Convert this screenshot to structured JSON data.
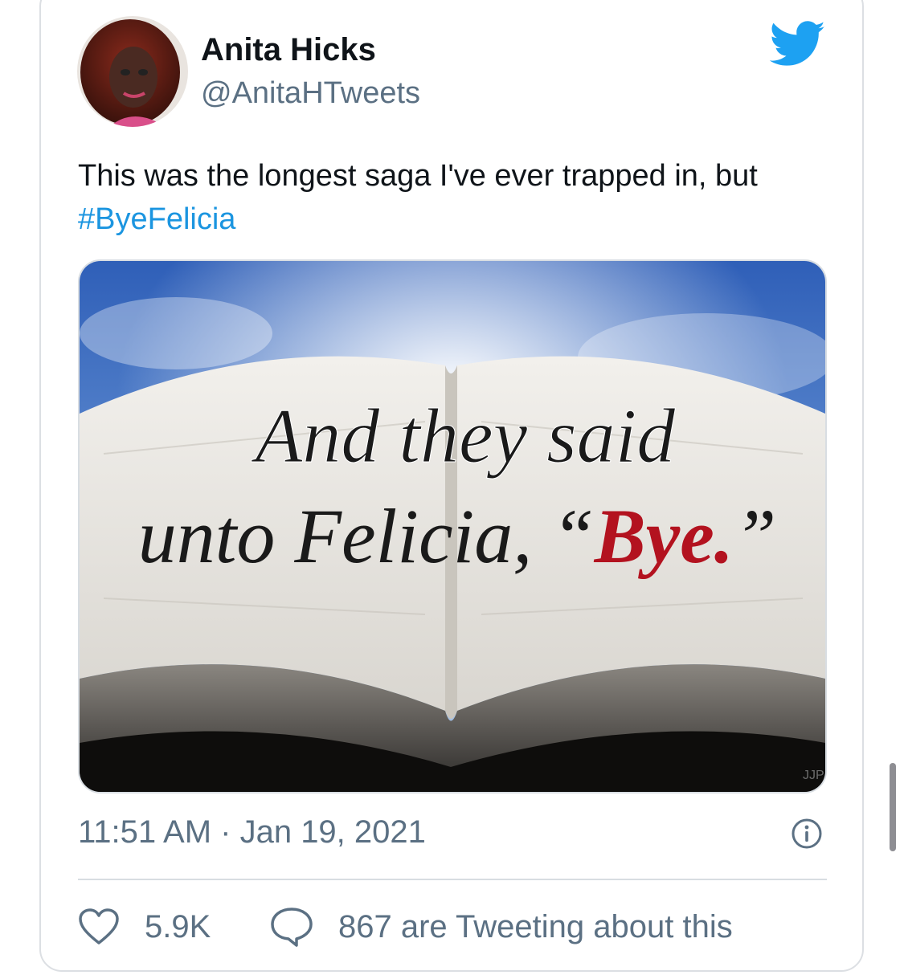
{
  "tweet": {
    "author_name": "Anita Hicks",
    "author_handle": "@AnitaHTweets",
    "text_main": "This was the longest saga I've ever trapped in, but ",
    "hashtag": "#ByeFelicia",
    "time": "11:51 AM · Jan 19, 2021",
    "like_count": "5.9K",
    "tweeting_text": "867 are Tweeting about this"
  },
  "media": {
    "line1": "And they said",
    "line2_prefix": "unto Felicia, “",
    "line2_bye": "Bye.",
    "line2_suffix": "”",
    "watermark": "JJP"
  },
  "icons": {
    "brand": "twitter-bird-icon",
    "info": "info-icon",
    "like": "heart-icon",
    "reply": "reply-bubble-icon"
  },
  "colors": {
    "brand_blue": "#1da1f2",
    "link_blue": "#1b95e0",
    "secondary_text": "#5b7083",
    "bye_red": "#b3121f"
  }
}
